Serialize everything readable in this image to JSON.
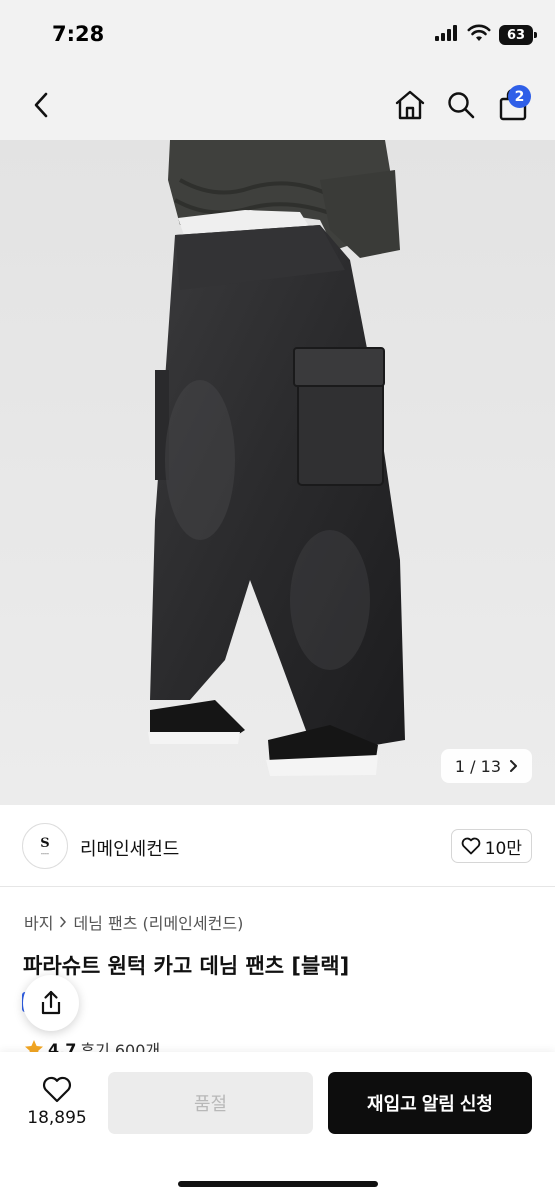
{
  "status_bar": {
    "time": "7:28",
    "battery": "63",
    "icons": [
      "cellular-signal-icon",
      "wifi-icon",
      "battery-icon"
    ]
  },
  "nav": {
    "icons": [
      "back-chevron-icon",
      "home-icon",
      "search-icon",
      "shopping-bag-icon"
    ],
    "cart_count": "2"
  },
  "gallery": {
    "counter": "1 / 13",
    "description": "product-photo-black-cargo-denim-pants"
  },
  "brand": {
    "name": "리메인세컨드",
    "logo_monogram": "S",
    "like_count": "10만"
  },
  "breadcrumb": {
    "items": [
      "바지",
      "데님 팬츠 (리메인세컨드)"
    ]
  },
  "product": {
    "title": "파라슈트 원턱 카고 데님 팬츠 [블랙]",
    "rating": "4.7",
    "reviews": "후기 600개"
  },
  "bottom_bar": {
    "wish_count": "18,895",
    "soldout_label": "품절",
    "restock_label": "재입고 알림 신청"
  },
  "colors": {
    "accent": "#2f5fe8",
    "star": "#f2a623",
    "primary_button": "#0d0d0d",
    "disabled_button": "#ececec",
    "header_bg": "#f2f2f2"
  }
}
